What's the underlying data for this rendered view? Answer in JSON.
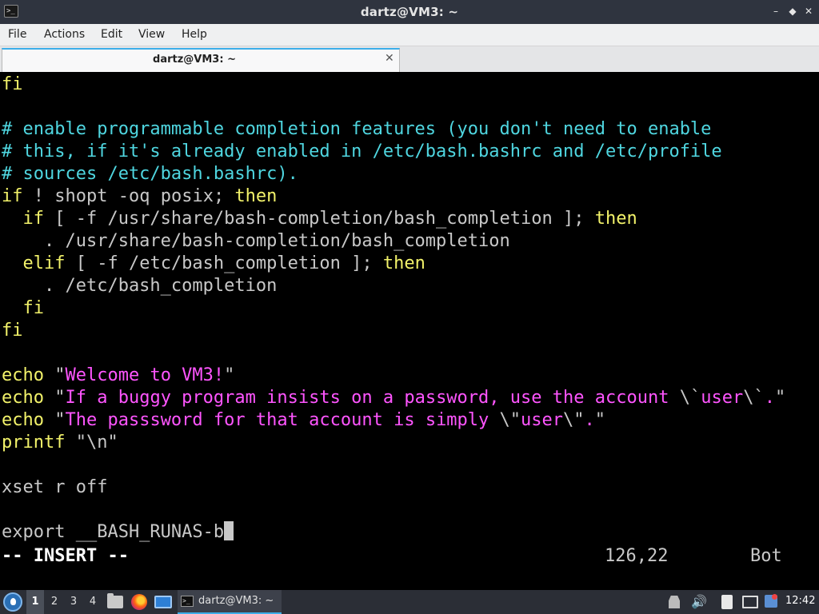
{
  "window": {
    "title": "dartz@VM3: ~",
    "app_icon_glyph": ">_",
    "min_glyph": "–",
    "max_glyph": "◆",
    "close_glyph": "✕"
  },
  "menu": {
    "items": [
      "File",
      "Actions",
      "Edit",
      "View",
      "Help"
    ]
  },
  "tabs": [
    {
      "label": "dartz@VM3: ~",
      "close_glyph": "✕"
    }
  ],
  "terminal": {
    "lines": [
      {
        "segments": [
          {
            "text": "fi",
            "color": "yellow"
          }
        ]
      },
      {
        "segments": []
      },
      {
        "segments": [
          {
            "text": "# enable programmable completion features (you don't need to enable",
            "color": "cyan"
          }
        ]
      },
      {
        "segments": [
          {
            "text": "# this, if it's already enabled in /etc/bash.bashrc and /etc/profile",
            "color": "cyan"
          }
        ]
      },
      {
        "segments": [
          {
            "text": "# sources /etc/bash.bashrc).",
            "color": "cyan"
          }
        ]
      },
      {
        "segments": [
          {
            "text": "if",
            "color": "yellow"
          },
          {
            "text": " ! ",
            "color": "gray"
          },
          {
            "text": "shopt",
            "color": "gray"
          },
          {
            "text": " -oq posix",
            "color": "gray"
          },
          {
            "text": "; ",
            "color": "gray"
          },
          {
            "text": "then",
            "color": "yellow"
          }
        ]
      },
      {
        "segments": [
          {
            "text": "  if",
            "color": "yellow"
          },
          {
            "text": " [ -f /usr/share/bash-completion/bash_completion ]",
            "color": "gray"
          },
          {
            "text": "; ",
            "color": "gray"
          },
          {
            "text": "then",
            "color": "yellow"
          }
        ]
      },
      {
        "segments": [
          {
            "text": "    . /usr/share/bash-completion/bash_completion",
            "color": "gray"
          }
        ]
      },
      {
        "segments": [
          {
            "text": "  elif",
            "color": "yellow"
          },
          {
            "text": " [ -f /etc/bash_completion ]",
            "color": "gray"
          },
          {
            "text": "; ",
            "color": "gray"
          },
          {
            "text": "then",
            "color": "yellow"
          }
        ]
      },
      {
        "segments": [
          {
            "text": "    . /etc/bash_completion",
            "color": "gray"
          }
        ]
      },
      {
        "segments": [
          {
            "text": "  fi",
            "color": "yellow"
          }
        ]
      },
      {
        "segments": [
          {
            "text": "fi",
            "color": "yellow"
          }
        ]
      },
      {
        "segments": []
      },
      {
        "segments": [
          {
            "text": "echo",
            "color": "yellow"
          },
          {
            "text": " \"",
            "color": "gray"
          },
          {
            "text": "Welcome to VM3!",
            "color": "magenta"
          },
          {
            "text": "\"",
            "color": "gray"
          }
        ]
      },
      {
        "segments": [
          {
            "text": "echo",
            "color": "yellow"
          },
          {
            "text": " \"",
            "color": "gray"
          },
          {
            "text": "If a buggy program insists on a password, use the account ",
            "color": "magenta"
          },
          {
            "text": "\\`",
            "color": "gray"
          },
          {
            "text": "user",
            "color": "magenta"
          },
          {
            "text": "\\`",
            "color": "gray"
          },
          {
            "text": ".",
            "color": "magenta"
          },
          {
            "text": "\"",
            "color": "gray"
          }
        ]
      },
      {
        "segments": [
          {
            "text": "echo",
            "color": "yellow"
          },
          {
            "text": " \"",
            "color": "gray"
          },
          {
            "text": "The passsword for that account is simply ",
            "color": "magenta"
          },
          {
            "text": "\\\"",
            "color": "gray"
          },
          {
            "text": "user",
            "color": "magenta"
          },
          {
            "text": "\\\"",
            "color": "gray"
          },
          {
            "text": ".",
            "color": "magenta"
          },
          {
            "text": "\"",
            "color": "gray"
          }
        ]
      },
      {
        "segments": [
          {
            "text": "printf",
            "color": "yellow"
          },
          {
            "text": " \"\\n\"",
            "color": "gray"
          }
        ]
      },
      {
        "segments": []
      },
      {
        "segments": [
          {
            "text": "xset r off",
            "color": "gray"
          }
        ]
      },
      {
        "segments": []
      },
      {
        "segments": [
          {
            "text": "export __BASH_RUNAS-b",
            "color": "gray"
          }
        ],
        "cursor": true
      }
    ],
    "mode": "-- INSERT --",
    "position": "126,22",
    "scroll_position": "Bot"
  },
  "colors": {
    "yellow": "#f2f26a",
    "cyan": "#4fd6e0",
    "gray": "#c8c8c8",
    "magenta": "#ff55ff",
    "accent": "#3daee9"
  },
  "taskbar": {
    "workspaces": [
      "1",
      "2",
      "3",
      "4"
    ],
    "active_workspace": "1",
    "task_label": "dartz@VM3: ~",
    "clock": "12:42",
    "volume_glyph": "🔊"
  }
}
